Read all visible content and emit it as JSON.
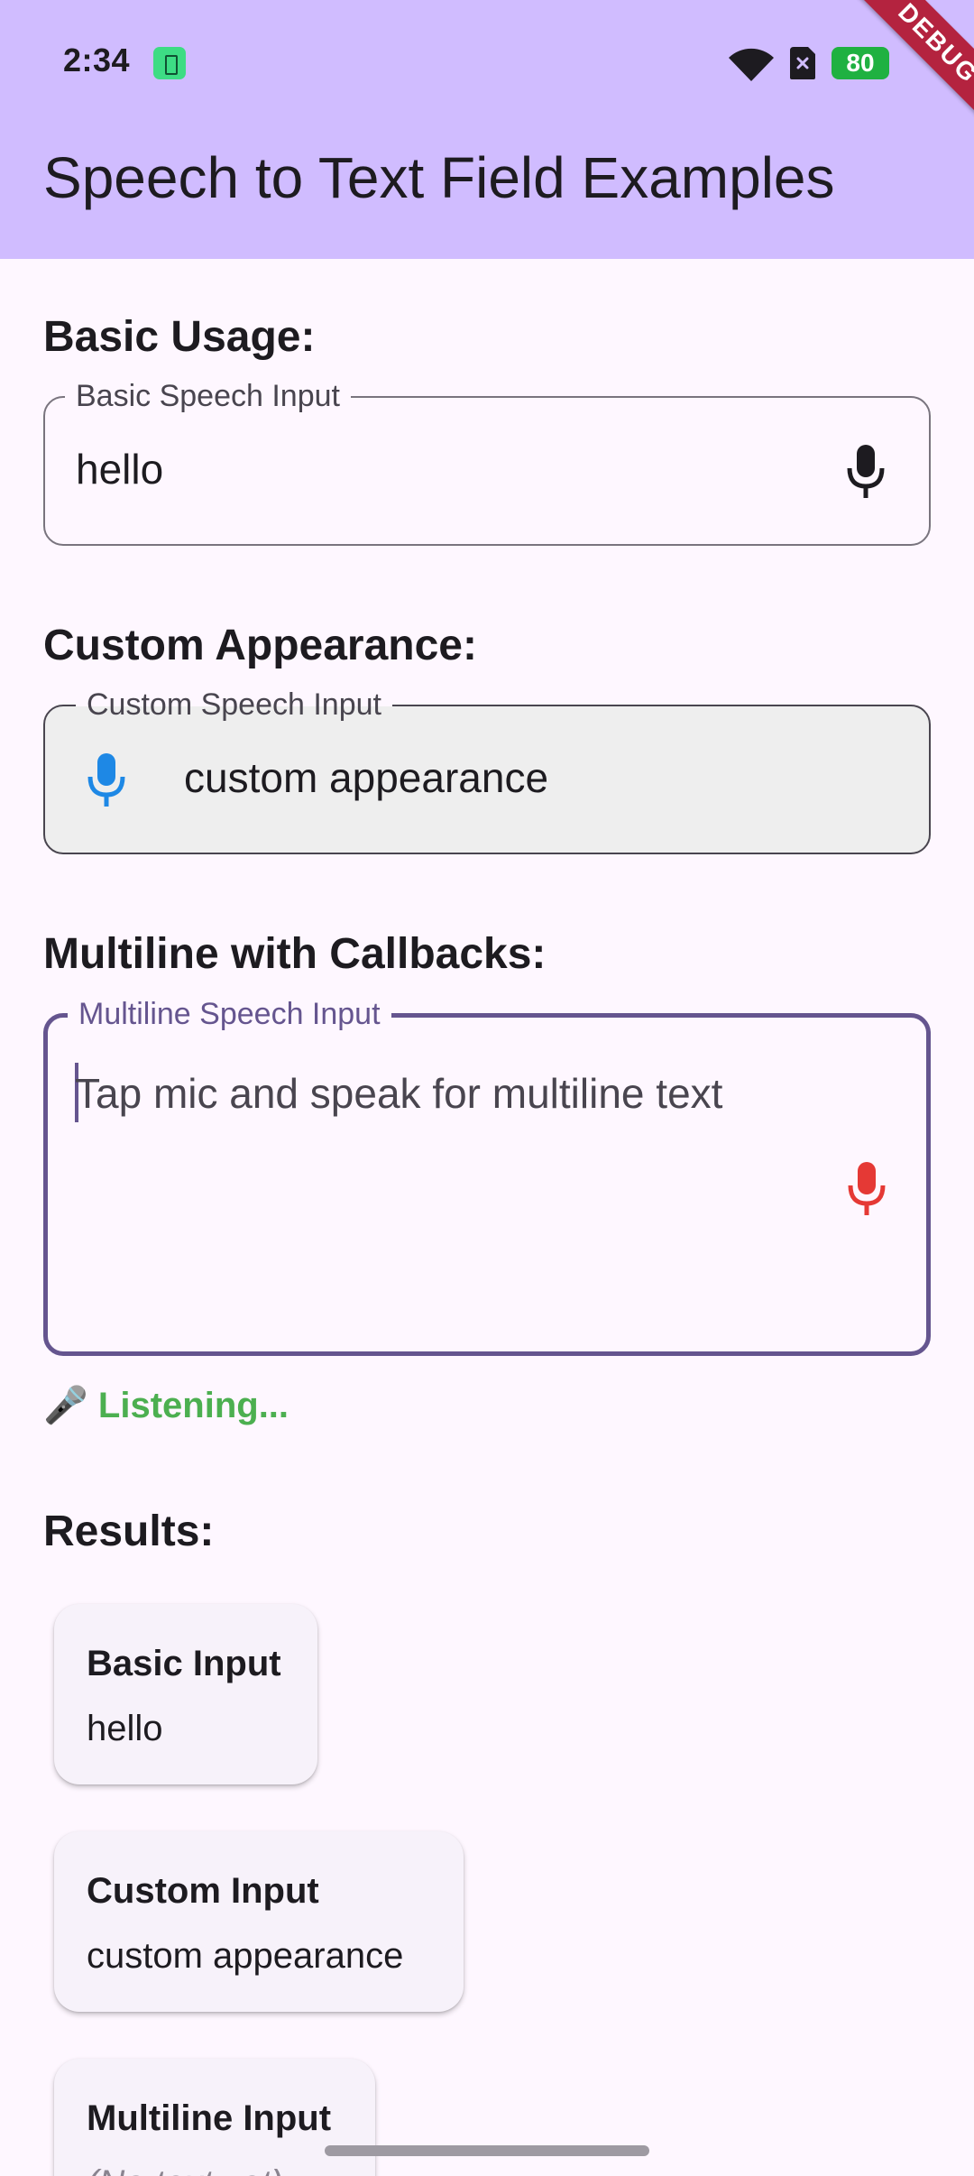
{
  "status_bar": {
    "time": "2:34",
    "battery": "80",
    "icons": [
      "battery-saver-icon",
      "wifi-icon",
      "sim-icon",
      "battery-icon",
      "notification-dot-icon"
    ]
  },
  "debug_banner": "DEBUG",
  "app_bar": {
    "title": "Speech to Text Field Examples",
    "color": "#d0bcff"
  },
  "sections": {
    "basic": {
      "heading": "Basic Usage:",
      "label": "Basic Speech Input",
      "value": "hello",
      "icon": "mic-icon"
    },
    "custom": {
      "heading": "Custom Appearance:",
      "label": "Custom Speech Input",
      "value": "custom appearance",
      "icon": "mic-icon",
      "icon_color": "#1e88e5"
    },
    "multiline": {
      "heading": "Multiline with Callbacks:",
      "label": "Multiline Speech Input",
      "placeholder": "Tap mic and speak for multiline text",
      "icon": "mic-icon",
      "icon_color": "#e53935",
      "status": "🎤 Listening..."
    }
  },
  "results": {
    "heading": "Results:",
    "cards": [
      {
        "title": "Basic Input",
        "value": "hello"
      },
      {
        "title": "Custom Input",
        "value": "custom appearance"
      },
      {
        "title": "Multiline Input",
        "value": "(No text yet)"
      }
    ]
  },
  "colors": {
    "background": "#fef7ff",
    "primary": "#65558f",
    "listening": "#4caf50"
  }
}
